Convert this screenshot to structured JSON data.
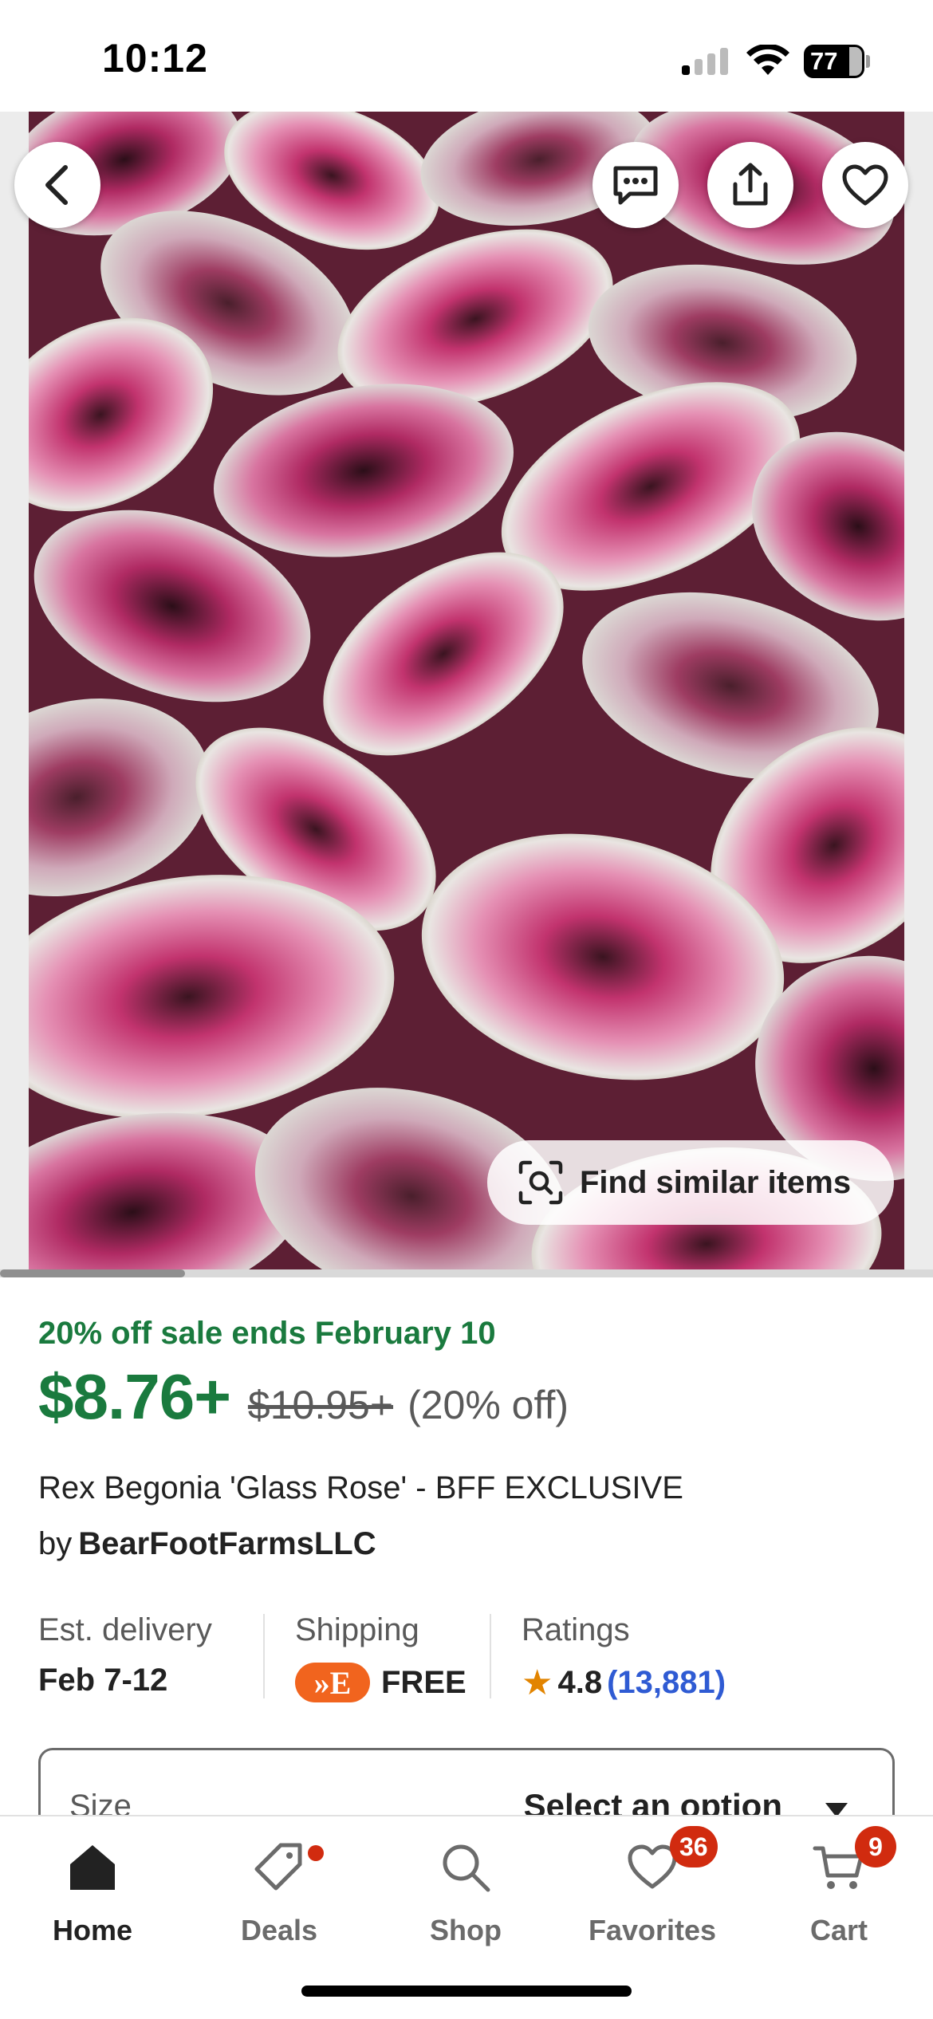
{
  "status_bar": {
    "time": "10:12",
    "battery": "77"
  },
  "hero": {
    "back_icon": "chevron-left-icon",
    "message_icon": "message-icon",
    "share_icon": "share-icon",
    "favorite_icon": "heart-icon",
    "find_similar_label": "Find similar items",
    "find_similar_icon": "visual-search-icon"
  },
  "product": {
    "sale_text": "20% off sale ends February 10",
    "price": "$8.76+",
    "original_price": "$10.95+",
    "discount": "(20% off)",
    "title": "Rex Begonia 'Glass Rose' - BFF EXCLUSIVE",
    "shop_prefix": "by",
    "shop_name": "BearFootFarmsLLC"
  },
  "meta": {
    "delivery_label": "Est. delivery",
    "delivery_value": "Feb 7-12",
    "shipping_label": "Shipping",
    "shipping_badge": "»E",
    "shipping_value": "FREE",
    "ratings_label": "Ratings",
    "rating_value": "4.8",
    "rating_count": "(13,881)"
  },
  "size_select": {
    "label": "Size",
    "value": "Select an option"
  },
  "tabs": [
    {
      "label": "Home",
      "icon": "home-icon",
      "active": true
    },
    {
      "label": "Deals",
      "icon": "tag-icon"
    },
    {
      "label": "Shop",
      "icon": "search-icon"
    },
    {
      "label": "Favorites",
      "icon": "heart-icon",
      "badge": "36"
    },
    {
      "label": "Cart",
      "icon": "cart-icon",
      "badge": "9"
    }
  ],
  "colors": {
    "sale_green": "#1a7a3e",
    "etsy_orange": "#f1641e",
    "badge_red": "#d12b0f",
    "link_blue": "#2f5bd3"
  }
}
